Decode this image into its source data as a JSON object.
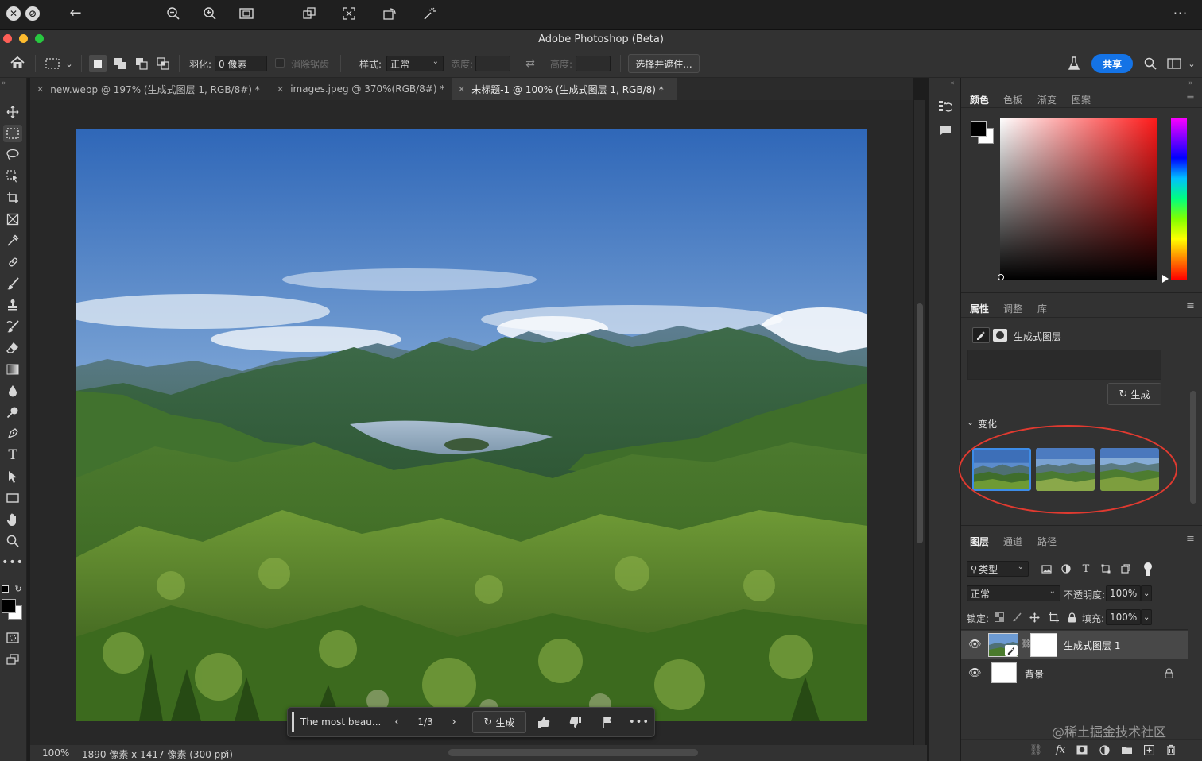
{
  "app": {
    "title": "Adobe Photoshop (Beta)",
    "top_more": "···"
  },
  "options": {
    "feather_label": "羽化:",
    "feather_value": "0 像素",
    "antialias_label": "消除锯齿",
    "style_label": "样式:",
    "style_value": "正常",
    "width_label": "宽度:",
    "height_label": "高度:",
    "select_mask_label": "选择并遮住...",
    "share_label": "共享"
  },
  "doc_tabs": [
    {
      "label": "new.webp @ 197% (生成式图层 1, RGB/8#) *"
    },
    {
      "label": "images.jpeg @ 370%(RGB/8#) *"
    },
    {
      "label": "未标题-1 @ 100% (生成式图层 1, RGB/8) *"
    }
  ],
  "contextbar": {
    "prompt": "The most beau...",
    "page": "1/3",
    "generate_label": "生成"
  },
  "status": {
    "zoom": "100%",
    "info": "1890 像素 x 1417 像素 (300 ppi)"
  },
  "color_panel": {
    "tabs": [
      "颜色",
      "色板",
      "渐变",
      "图案"
    ],
    "hue_color": "#ff1a1a"
  },
  "properties_panel": {
    "tabs": [
      "属性",
      "调整",
      "库"
    ],
    "layer_type": "生成式图层",
    "generate_label": "生成",
    "variations_label": "变化",
    "variation_count": 3
  },
  "layers_panel": {
    "tabs": [
      "图层",
      "通道",
      "路径"
    ],
    "filter_label": "类型",
    "blend_mode": "正常",
    "opacity_label": "不透明度:",
    "opacity_value": "100%",
    "lock_label": "锁定:",
    "fill_label": "填充:",
    "fill_value": "100%",
    "layers": [
      {
        "name": "生成式图层 1"
      },
      {
        "name": "背景"
      }
    ]
  },
  "watermark": "@稀土掘金技术社区"
}
